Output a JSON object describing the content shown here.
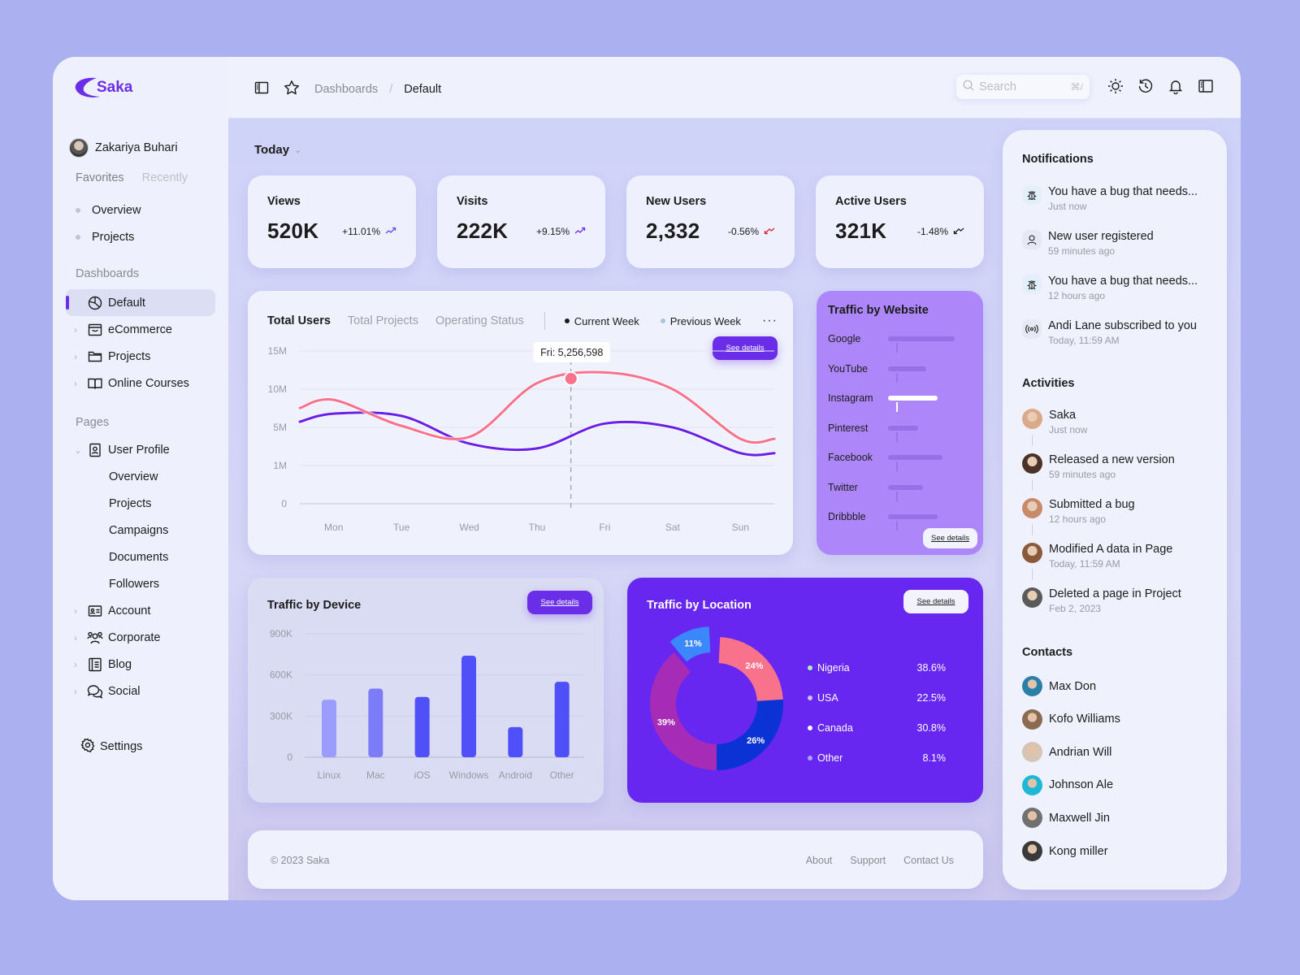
{
  "app": {
    "name": "Saka",
    "brand_color": "#6a2ee8"
  },
  "sidebar": {
    "user_name": "Zakariya Buhari",
    "tabs": [
      {
        "label": "Favorites",
        "active": true
      },
      {
        "label": "Recently",
        "active": false
      }
    ],
    "favorites": [
      {
        "label": "Overview"
      },
      {
        "label": "Projects"
      }
    ],
    "dashboards_label": "Dashboards",
    "dashboards": [
      {
        "label": "Default",
        "icon": "pie-chart-icon",
        "active": true
      },
      {
        "label": "eCommerce",
        "icon": "shopping-bag-icon"
      },
      {
        "label": "Projects",
        "icon": "folder-icon"
      },
      {
        "label": "Online Courses",
        "icon": "book-icon"
      }
    ],
    "pages_label": "Pages",
    "pages": [
      {
        "label": "User Profile",
        "icon": "user-badge-icon",
        "expanded": true
      },
      {
        "label": "Overview",
        "sub": true
      },
      {
        "label": "Projects",
        "sub": true
      },
      {
        "label": "Campaigns",
        "sub": true
      },
      {
        "label": "Documents",
        "sub": true
      },
      {
        "label": "Followers",
        "sub": true
      },
      {
        "label": "Account",
        "icon": "id-card-icon"
      },
      {
        "label": "Corporate",
        "icon": "users-icon"
      },
      {
        "label": "Blog",
        "icon": "notebook-icon"
      },
      {
        "label": "Social",
        "icon": "chat-icon"
      }
    ],
    "settings_label": "Settings"
  },
  "topbar": {
    "breadcrumb": [
      "Dashboards",
      "Default"
    ],
    "search_placeholder": "Search",
    "search_shortcut": "⌘/"
  },
  "main": {
    "date_filter": "Today",
    "stats": [
      {
        "title": "Views",
        "value": "520K",
        "change": "+11.01%",
        "trend": "up",
        "color": "#5b4ff0"
      },
      {
        "title": "Visits",
        "value": "222K",
        "change": "+9.15%",
        "trend": "up",
        "color": "#6a2ee8"
      },
      {
        "title": "New Users",
        "value": "2,332",
        "change": "-0.56%",
        "trend": "down",
        "color": "#e0222a"
      },
      {
        "title": "Active Users",
        "value": "321K",
        "change": "-1.48%",
        "trend": "down",
        "color": "#1c1c1c"
      }
    ],
    "users_chart": {
      "tabs": [
        {
          "label": "Total Users",
          "active": true
        },
        {
          "label": "Total Projects"
        },
        {
          "label": "Operating Status"
        }
      ],
      "legend": [
        {
          "label": "Current Week",
          "color": "#1c1c1c"
        },
        {
          "label": "Previous Week",
          "color": "#a8c5da"
        }
      ],
      "see_details": "See details",
      "tooltip": "Fri: 5,256,598"
    },
    "website": {
      "title": "Traffic by Website",
      "see_details": "See details",
      "sites": [
        {
          "name": "Google",
          "value": 0.82
        },
        {
          "name": "YouTube",
          "value": 0.47
        },
        {
          "name": "Instagram",
          "value": 0.61,
          "highlight": true
        },
        {
          "name": "Pinterest",
          "value": 0.37
        },
        {
          "name": "Facebook",
          "value": 0.67
        },
        {
          "name": "Twitter",
          "value": 0.43
        },
        {
          "name": "Dribbble",
          "value": 0.61
        }
      ]
    },
    "device": {
      "title": "Traffic by Device",
      "see_details": "See details"
    },
    "location": {
      "title": "Traffic by Location",
      "see_details": "See details",
      "legend": [
        {
          "name": "Nigeria",
          "value": "38.6%",
          "dot": "#a7f3b8"
        },
        {
          "name": "USA",
          "value": "22.5%",
          "dot": "#c9c3f5"
        },
        {
          "name": "Canada",
          "value": "30.8%",
          "dot": "#ffffff"
        },
        {
          "name": "Other",
          "value": "8.1%",
          "dot": "#a8a6f8"
        }
      ]
    },
    "footer": {
      "copyright": "© 2023 Saka",
      "links": [
        "About",
        "Support",
        "Contact Us"
      ]
    }
  },
  "right_panel": {
    "notifications_title": "Notifications",
    "notifications": [
      {
        "text": "You have a bug that needs...",
        "time": "Just now",
        "icon": "bug-icon",
        "bg": "#e3f0fb"
      },
      {
        "text": "New user registered",
        "time": "59 minutes ago",
        "icon": "user-icon",
        "bg": "#e6e8f4"
      },
      {
        "text": "You have a bug that needs...",
        "time": "12 hours ago",
        "icon": "bug-icon",
        "bg": "#e3f0fb"
      },
      {
        "text": "Andi Lane subscribed to you",
        "time": "Today, 11:59 AM",
        "icon": "broadcast-icon",
        "bg": "#e6e8f4"
      }
    ],
    "activities_title": "Activities",
    "activities": [
      {
        "text": "Saka",
        "time": "Just now",
        "avatar": "#d9a98a"
      },
      {
        "text": "Released a new version",
        "time": "59 minutes ago",
        "avatar": "#4a3228"
      },
      {
        "text": "Submitted a bug",
        "time": "12 hours ago",
        "avatar": "#c98a6a"
      },
      {
        "text": "Modified A data in Page",
        "time": "Today, 11:59 AM",
        "avatar": "#8a5a3c"
      },
      {
        "text": "Deleted a page in Project",
        "time": "Feb 2, 2023",
        "avatar": "#5a5a5a"
      }
    ],
    "contacts_title": "Contacts",
    "contacts": [
      {
        "name": "Max Don",
        "avatar": "#2a7fa8"
      },
      {
        "name": "Kofo Williams",
        "avatar": "#8a6a50"
      },
      {
        "name": "Andrian Will",
        "avatar": "#d8c4b4"
      },
      {
        "name": "Johnson Ale",
        "avatar": "#1fb7d6"
      },
      {
        "name": "Maxwell Jin",
        "avatar": "#707070"
      },
      {
        "name": "Kong miller",
        "avatar": "#3a3a3a"
      }
    ]
  },
  "chart_data": [
    {
      "type": "line",
      "title": "Total Users",
      "categories": [
        "Mon",
        "Tue",
        "Wed",
        "Thu",
        "Fri",
        "Sat",
        "Sun"
      ],
      "y_ticks": [
        "0",
        "1M",
        "5M",
        "10M",
        "15M"
      ],
      "series": [
        {
          "name": "Current Week",
          "color": "#6a1fe8",
          "values": [
            6.8,
            6.5,
            3.3,
            2.8,
            5.5,
            5.0,
            2.3
          ]
        },
        {
          "name": "Previous Week",
          "color": "#f8728c",
          "values": [
            8.6,
            5.2,
            4.0,
            10.8,
            12.2,
            10.0,
            3.8
          ]
        }
      ],
      "highlight": {
        "category": "Fri",
        "label": "Fri: 5,256,598"
      },
      "grid": true
    },
    {
      "type": "bar",
      "title": "Traffic by Device",
      "categories": [
        "Linux",
        "Mac",
        "iOS",
        "Windows",
        "Android",
        "Other"
      ],
      "values": [
        420000,
        500000,
        440000,
        740000,
        220000,
        550000
      ],
      "colors": [
        "#9c9cfe",
        "#7c7cf8",
        "#5050f8",
        "#5050f8",
        "#5050f8",
        "#5050f8"
      ],
      "y_ticks": [
        "0",
        "300K",
        "600K",
        "900K"
      ],
      "ylim": [
        0,
        900000
      ],
      "grid": true
    },
    {
      "type": "pie",
      "title": "Traffic by Location",
      "slices": [
        {
          "label": "24%",
          "value": 24,
          "color": "#f8728c"
        },
        {
          "label": "26%",
          "value": 26,
          "color": "#0b32d4"
        },
        {
          "label": "39%",
          "value": 39,
          "color": "#a62bb6"
        },
        {
          "label": "11%",
          "value": 11,
          "color": "#3b88fd"
        }
      ]
    }
  ]
}
